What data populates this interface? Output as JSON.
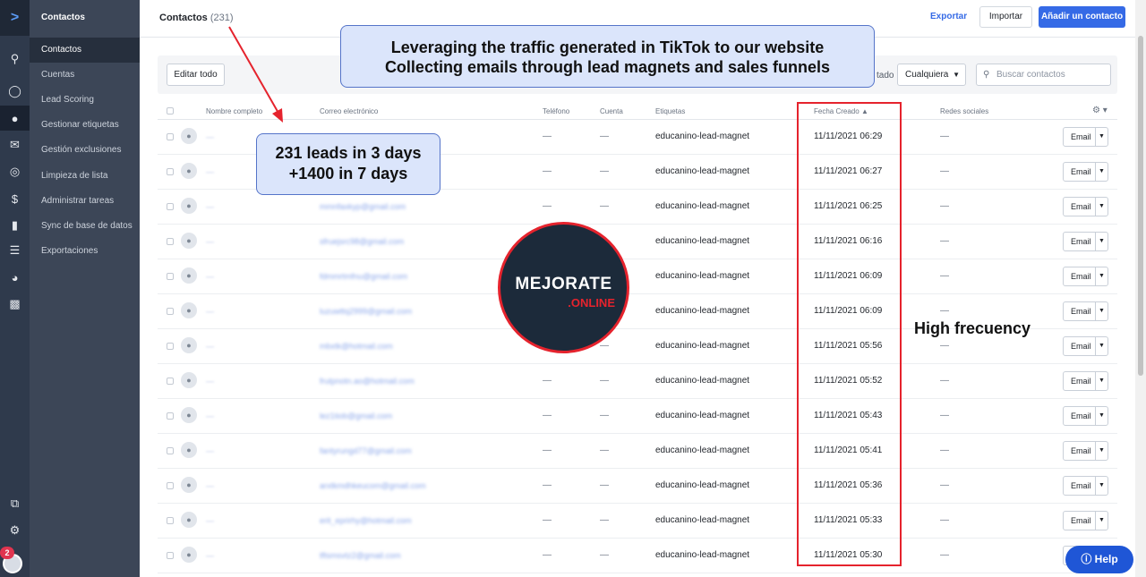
{
  "rail": {
    "logo": ">",
    "icons": [
      "search-icon",
      "lightbulb-icon",
      "contacts-icon",
      "mail-icon",
      "target-icon",
      "dollar-icon",
      "chat-icon",
      "list-icon",
      "globe-icon",
      "chart-icon",
      "copy-icon",
      "gear-icon"
    ],
    "badge": "2"
  },
  "subnav": {
    "title": "Contactos",
    "items": [
      "Contactos",
      "Cuentas",
      "Lead Scoring",
      "Gestionar etiquetas",
      "Gestión exclusiones",
      "Limpieza de lista",
      "Administrar tareas",
      "Sync de base de datos",
      "Exportaciones"
    ]
  },
  "header": {
    "title": "Contactos",
    "count": "(231)",
    "export_label": "Exportar",
    "import_label": "Importar",
    "add_label": "Añadir un contacto"
  },
  "filters": {
    "edit_all": "Editar todo",
    "status_label": "tado",
    "status_value": "Cualquiera",
    "search_placeholder": "Buscar contactos"
  },
  "table": {
    "columns": [
      "Nombre completo",
      "Correo electrónico",
      "Teléfono",
      "Cuenta",
      "Etiquetas",
      "Fecha Creado",
      "Redes sociales"
    ],
    "rows": [
      {
        "name": "—",
        "email": "",
        "phone": "—",
        "account": "—",
        "tag": "educanino-lead-magnet",
        "date": "11/11/2021 06:29",
        "social": "—"
      },
      {
        "name": "—",
        "email": "",
        "phone": "—",
        "account": "—",
        "tag": "educanino-lead-magnet",
        "date": "11/11/2021 06:27",
        "social": "—"
      },
      {
        "name": "—",
        "email": "mmnfaxkyp@gmail.com",
        "phone": "—",
        "account": "—",
        "tag": "educanino-lead-magnet",
        "date": "11/11/2021 06:25",
        "social": "—"
      },
      {
        "name": "—",
        "email": "sfruejsrc98@gmail.com",
        "phone": "—",
        "account": "—",
        "tag": "educanino-lead-magnet",
        "date": "11/11/2021 06:16",
        "social": "—"
      },
      {
        "name": "—",
        "email": "fdmmrtmfnu@gmail.com",
        "phone": "—",
        "account": "—",
        "tag": "educanino-lead-magnet",
        "date": "11/11/2021 06:09",
        "social": "—"
      },
      {
        "name": "—",
        "email": "luzuwttq2999@gmail.com",
        "phone": "—",
        "account": "—",
        "tag": "educanino-lead-magnet",
        "date": "11/11/2021 06:09",
        "social": "—"
      },
      {
        "name": "—",
        "email": "mbxtk@hotmail.com",
        "phone": "—",
        "account": "—",
        "tag": "educanino-lead-magnet",
        "date": "11/11/2021 05:56",
        "social": "—"
      },
      {
        "name": "—",
        "email": "frutpnotn.ao@hotmail.com",
        "phone": "—",
        "account": "—",
        "tag": "educanino-lead-magnet",
        "date": "11/11/2021 05:52",
        "social": "—"
      },
      {
        "name": "—",
        "email": "lez1tiob@gmail.com",
        "phone": "—",
        "account": "—",
        "tag": "educanino-lead-magnet",
        "date": "11/11/2021 05:43",
        "social": "—"
      },
      {
        "name": "—",
        "email": "fantyrungd77@gmail.com",
        "phone": "—",
        "account": "—",
        "tag": "educanino-lead-magnet",
        "date": "11/11/2021 05:41",
        "social": "—"
      },
      {
        "name": "—",
        "email": "arxtkmdhkeucom@gmail.com",
        "phone": "—",
        "account": "—",
        "tag": "educanino-lead-magnet",
        "date": "11/11/2021 05:36",
        "social": "—"
      },
      {
        "name": "—",
        "email": "erit_eprirhy@hotmail.com",
        "phone": "—",
        "account": "—",
        "tag": "educanino-lead-magnet",
        "date": "11/11/2021 05:33",
        "social": "—"
      },
      {
        "name": "—",
        "email": "tftsmsvtz2@gmail.com",
        "phone": "—",
        "account": "—",
        "tag": "educanino-lead-magnet",
        "date": "11/11/2021 05:30",
        "social": "—"
      }
    ],
    "email_button": "Email"
  },
  "annotations": {
    "top_line1": "Leveraging the traffic generated in TikTok to our website",
    "top_line2": "Collecting emails through lead magnets and sales funnels",
    "leads_line1": "231 leads in 3 days",
    "leads_line2": "+1400 in 7 days",
    "frequency": "High frecuency",
    "logo_main": "MEJORATE",
    "logo_sub": ".ONLINE",
    "accent": "#e5232d"
  },
  "help_label": "Help"
}
